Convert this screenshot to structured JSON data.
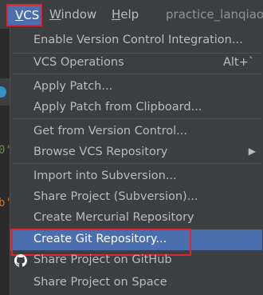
{
  "menubar": {
    "items": [
      {
        "prefix": "",
        "underline": "V",
        "rest": "CS"
      },
      {
        "prefix": "",
        "underline": "W",
        "rest": "indow"
      },
      {
        "prefix": "",
        "underline": "H",
        "rest": "elp"
      }
    ],
    "project_title": "practice_lanqiao"
  },
  "editor_fragments": [
    "0'",
    "b'"
  ],
  "menu": {
    "items": [
      {
        "label": "Enable Version Control Integration...",
        "shortcut": ""
      },
      {
        "label": "VCS Operations",
        "shortcut": "Alt+`"
      },
      {
        "label": "Apply Patch...",
        "shortcut": ""
      },
      {
        "label": "Apply Patch from Clipboard...",
        "shortcut": ""
      },
      {
        "label": "Get from Version Control...",
        "shortcut": ""
      },
      {
        "label": "Browse VCS Repository",
        "shortcut": ""
      },
      {
        "label": "Import into Subversion...",
        "shortcut": ""
      },
      {
        "label": "Share Project (Subversion)...",
        "shortcut": ""
      },
      {
        "label": "Create Mercurial Repository",
        "shortcut": ""
      },
      {
        "label": "Create Git Repository...",
        "shortcut": ""
      },
      {
        "label": "Share Project on GitHub",
        "shortcut": ""
      },
      {
        "label": "Share Project on Space",
        "shortcut": ""
      }
    ],
    "selected": "Create Git Repository..."
  },
  "icons": {
    "github": "github-icon",
    "submenu": "chevron-right-icon"
  },
  "colors": {
    "menu_bg": "#3c3f41",
    "selection": "#4b6eaf",
    "highlight_outline": "#e0242c"
  }
}
